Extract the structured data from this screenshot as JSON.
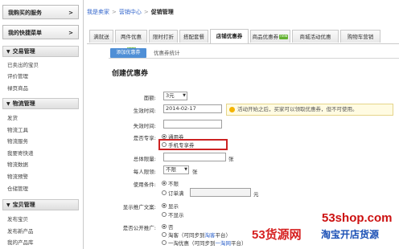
{
  "sidebar": {
    "my_services": "我购买的服务",
    "shortcuts": "我的快捷菜单",
    "arrow": ">",
    "sections": [
      {
        "title": "交易管理",
        "items": [
          "已卖出的宝贝",
          "评价管理",
          "禄页商品"
        ]
      },
      {
        "title": "物流管理",
        "items": [
          "发货",
          "物流工具",
          "物流服务",
          "我要寄快递",
          "物流数据",
          "物流预警",
          "仓储管理"
        ]
      },
      {
        "title": "宝贝管理",
        "items": [
          "发布宝贝",
          "发布新产品",
          "我的产品库"
        ]
      }
    ]
  },
  "breadcrumb": {
    "home": "我是卖家",
    "section": "营销中心",
    "current": "促销管理",
    "sep": ">"
  },
  "tabs": [
    {
      "label": "满就送",
      "new": false
    },
    {
      "label": "两件优惠",
      "new": true
    },
    {
      "label": "限时打折",
      "new": false
    },
    {
      "label": "搭配套餐",
      "new": false
    },
    {
      "label": "店铺优惠券",
      "new": false,
      "active": true
    },
    {
      "label": "商品优惠券",
      "new": true
    },
    {
      "label": "商城活动优惠",
      "new": false
    },
    {
      "label": "购物车营销",
      "new": false
    }
  ],
  "new_badge": "new",
  "subtabs": {
    "add": "添加优惠券",
    "stats": "优惠券统计"
  },
  "form": {
    "title": "创建优惠券",
    "denomination_label": "面额:",
    "denomination_value": "3元",
    "start_label": "生效时间:",
    "start_value": "2014-02-17",
    "tip": "活动开始之后，买家可以领取优惠券，但不可使用。",
    "end_label": "失效时间:",
    "exclusive_label": "是否专享:",
    "exclusive_opt1": "通用券",
    "exclusive_opt2": "手机专享券",
    "total_label": "总体限量:",
    "total_unit": "张",
    "per_user_label": "每人限领:",
    "per_user_value": "不限",
    "per_user_unit": "张",
    "condition_label": "使用条件:",
    "condition_opt1": "不限",
    "condition_opt2": "订单满",
    "condition_unit": "元",
    "show_label": "显示推广文案:",
    "show_opt1": "显示",
    "show_opt2": "不显示",
    "public_label": "是否公开推广:",
    "public_opt1": "否",
    "public_opt2_a": "淘客（可同步到",
    "public_opt2_link": "淘客",
    "public_opt2_b": "平台）",
    "public_opt3_a": "一淘优惠（可同步到",
    "public_opt3_link": "一淘网",
    "public_opt3_b": "平台）"
  },
  "watermark": {
    "url": "53shop.com",
    "brand": "53货源网",
    "slogan": "淘宝开店货源"
  }
}
